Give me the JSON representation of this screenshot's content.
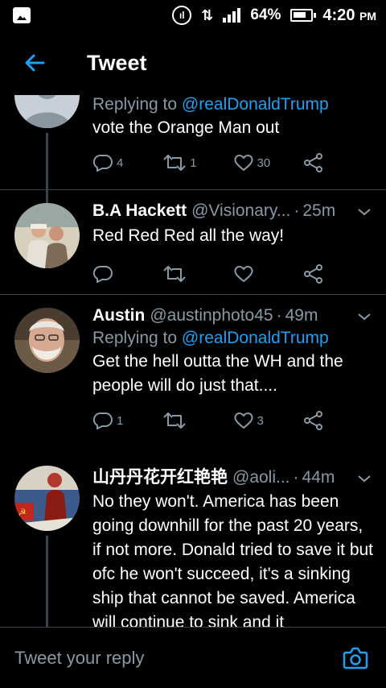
{
  "status_bar": {
    "battery": "64%",
    "time": "4:20",
    "ampm": "PM",
    "icons": [
      "gallery-icon",
      "nfc-icon",
      "data-arrows-icon",
      "signal-icon",
      "battery-icon"
    ]
  },
  "header": {
    "back_icon": "back-arrow-icon",
    "title": "Tweet"
  },
  "tweets": [
    {
      "reply_prefix": "Replying to",
      "mention": "@realDonaldTrump",
      "text": "vote the Orange Man out",
      "replies": "4",
      "retweets": "1",
      "likes": "30"
    },
    {
      "name": "B.A Hackett",
      "handle": "@Visionary...",
      "dot": "·",
      "time": "25m",
      "text": "Red Red Red all the way!",
      "replies": "",
      "retweets": "",
      "likes": ""
    },
    {
      "name": "Austin",
      "handle": "@austinphoto45",
      "dot": "·",
      "time": "49m",
      "reply_prefix": "Replying to",
      "mention": "@realDonaldTrump",
      "text": "Get the hell outta the WH and the people will do just that....",
      "replies": "1",
      "retweets": "",
      "likes": "3"
    },
    {
      "name": "山丹丹花开红艳艳",
      "handle": "@aoli...",
      "dot": "·",
      "time": "44m",
      "text": "No they won't. America has been going downhill for the past 20 years, if not more. Donald tried to save it but ofc he won't succeed, it's a sinking ship that cannot be saved. America will continue to sink and it"
    }
  ],
  "reply_bar": {
    "placeholder": "Tweet your reply",
    "camera_icon": "camera-icon"
  },
  "colors": {
    "background": "#000000",
    "accent": "#1da1f2",
    "secondary_text": "#8899a6",
    "divider": "#38444d"
  }
}
